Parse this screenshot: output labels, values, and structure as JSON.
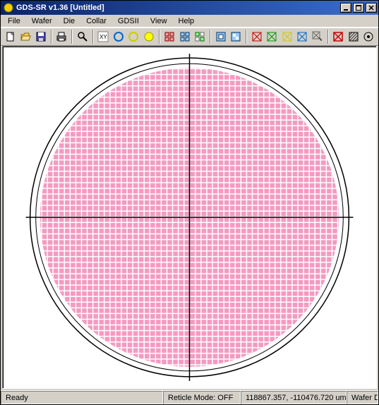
{
  "window": {
    "title": "GDS-SR v1.36 [Untitled]"
  },
  "menubar": {
    "items": [
      "File",
      "Wafer",
      "Die",
      "Collar",
      "GDSII",
      "View",
      "Help"
    ]
  },
  "toolbar": {
    "icons": [
      "new-icon",
      "open-icon",
      "save-icon",
      "sep",
      "print-icon",
      "sep",
      "zoom-icon",
      "sep",
      "xy-icon",
      "circle-blue-icon",
      "circle-yellow-outline-icon",
      "circle-yellow-fill-icon",
      "sep",
      "grid1-icon",
      "grid2-icon",
      "grid3-icon",
      "sep",
      "die1-icon",
      "die2-icon",
      "sep",
      "collar-red-icon",
      "collar-green-icon",
      "collar-yellow-icon",
      "collar-blue-icon",
      "collar-pointer-icon",
      "sep",
      "gds-red-icon",
      "hatch-icon",
      "drill-icon"
    ]
  },
  "statusbar": {
    "ready": "Ready",
    "reticle": "Reticle Mode: OFF",
    "coords": "118867.357, -110476.720 um",
    "wafer": "Wafer D"
  },
  "colors": {
    "titlebar_left": "#0a246a",
    "titlebar_right": "#3a6ecb",
    "wafer_grid": "#f49ac1",
    "wafer_grid_gap": "#ffffff",
    "wafer_outline": "#000000"
  }
}
